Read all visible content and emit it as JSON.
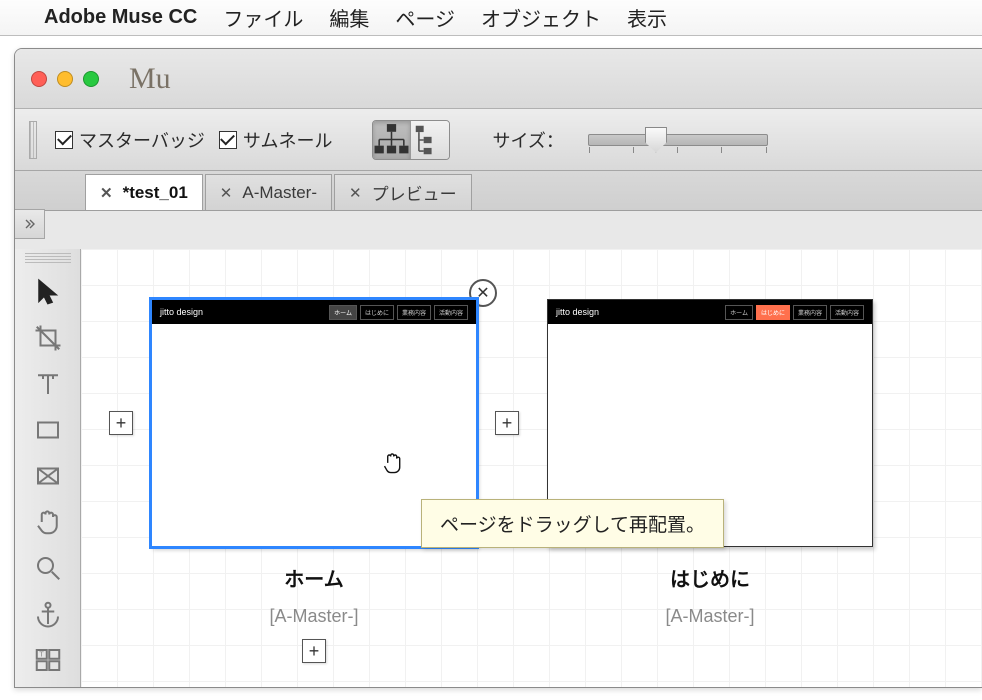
{
  "menubar": {
    "appname": "Adobe Muse CC",
    "items": [
      "ファイル",
      "編集",
      "ページ",
      "オブジェクト",
      "表示"
    ]
  },
  "window": {
    "title_icon": "Mu"
  },
  "optionsbar": {
    "master_badge_label": "マスターバッジ",
    "thumbnail_label": "サムネール",
    "size_label": "サイズ："
  },
  "tabs": [
    {
      "label": "*test_01",
      "active": true
    },
    {
      "label": "A-Master-",
      "active": false
    },
    {
      "label": "プレビュー",
      "active": false
    }
  ],
  "pages": [
    {
      "name": "ホーム",
      "master": "[A-Master-]",
      "selected": true,
      "logo": "jitto design",
      "nav": [
        "ホーム",
        "はじめに",
        "業務内容",
        "活動内容"
      ],
      "nav_active_index": 0
    },
    {
      "name": "はじめに",
      "master": "[A-Master-]",
      "selected": false,
      "logo": "jitto design",
      "nav": [
        "ホーム",
        "はじめに",
        "業務内容",
        "活動内容"
      ],
      "nav_active_index": 1
    }
  ],
  "tooltip": "ページをドラッグして再配置。",
  "icons": {
    "sitemap": "sitemap-icon",
    "outline": "outline-icon"
  }
}
